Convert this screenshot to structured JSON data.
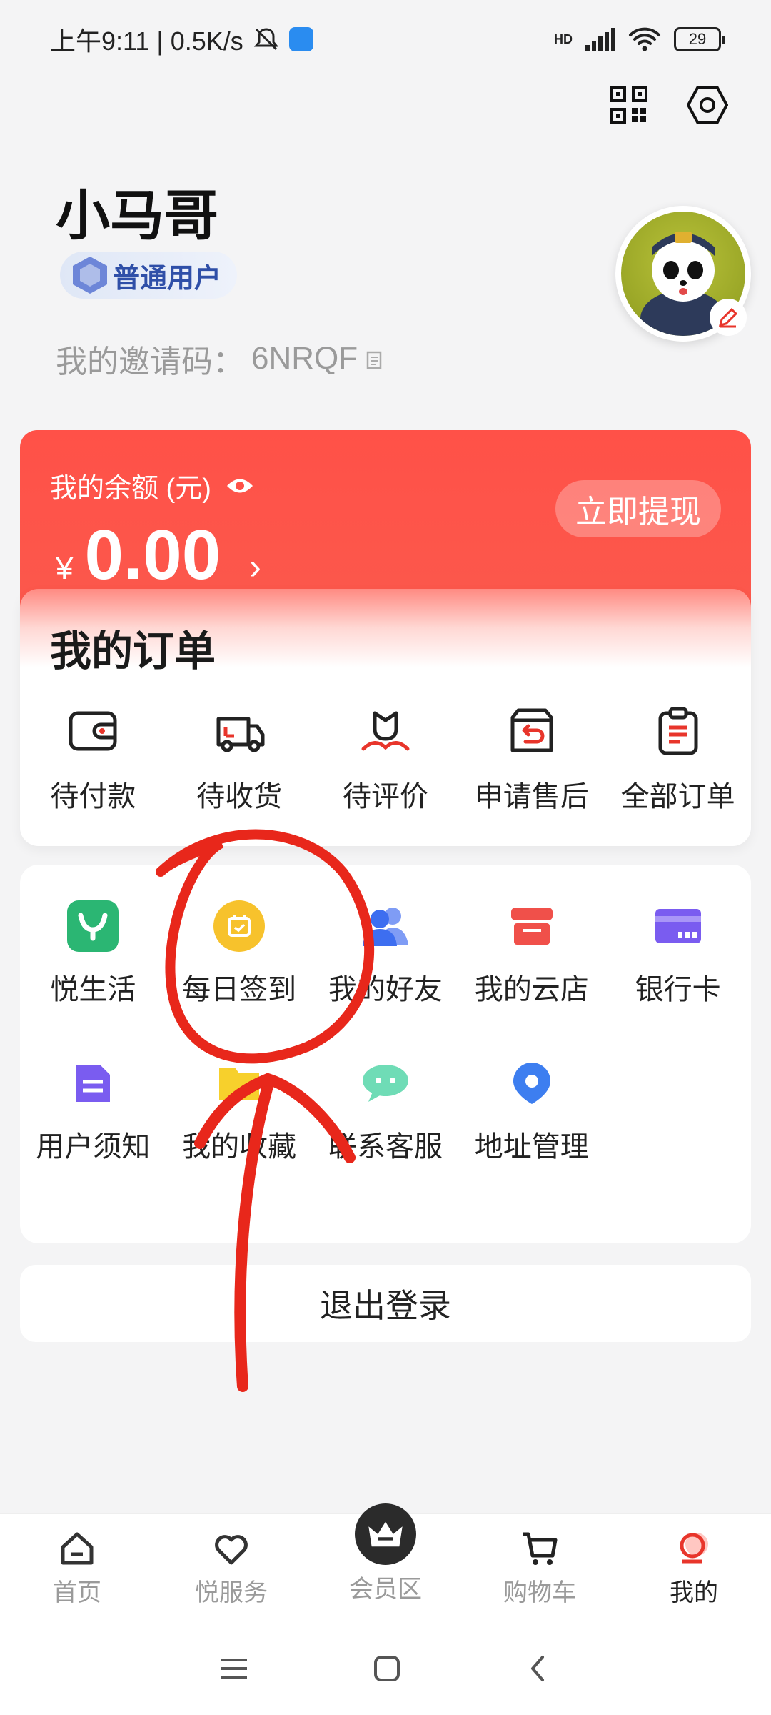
{
  "status_bar": {
    "time": "上午9:11 | 0.5K/s",
    "battery": "29",
    "network": "HD"
  },
  "profile": {
    "name": "小马哥",
    "level": "普通用户",
    "invite_label": "我的邀请码：",
    "invite_code": "6NRQF"
  },
  "balance": {
    "label": "我的余额 (元)",
    "currency": "¥",
    "amount": "0.00",
    "withdraw_label": "立即提现"
  },
  "orders": {
    "title": "我的订单",
    "items": [
      {
        "label": "待付款",
        "icon": "wallet-icon"
      },
      {
        "label": "待收货",
        "icon": "truck-icon"
      },
      {
        "label": "待评价",
        "icon": "flower-icon"
      },
      {
        "label": "申请售后",
        "icon": "return-box-icon"
      },
      {
        "label": "全部订单",
        "icon": "clipboard-icon"
      }
    ]
  },
  "services": [
    {
      "label": "悦生活",
      "icon": "yue-life-icon",
      "color": "#2bb673"
    },
    {
      "label": "每日签到",
      "icon": "calendar-check-icon",
      "color": "#f7c22c"
    },
    {
      "label": "我的好友",
      "icon": "friends-icon",
      "color": "#3d6ef0"
    },
    {
      "label": "我的云店",
      "icon": "store-icon",
      "color": "#f0504a"
    },
    {
      "label": "银行卡",
      "icon": "bank-card-icon",
      "color": "#7a5cf0"
    },
    {
      "label": "用户须知",
      "icon": "document-icon",
      "color": "#7a5cf0"
    },
    {
      "label": "我的收藏",
      "icon": "folder-icon",
      "color": "#f7c22c"
    },
    {
      "label": "联系客服",
      "icon": "chat-icon",
      "color": "#4fd1a8"
    },
    {
      "label": "地址管理",
      "icon": "location-pin-icon",
      "color": "#3d7ef0"
    }
  ],
  "logout_label": "退出登录",
  "bottom_nav": [
    {
      "label": "首页",
      "icon": "home-icon"
    },
    {
      "label": "悦服务",
      "icon": "heart-icon"
    },
    {
      "label": "会员区",
      "icon": "crown-icon"
    },
    {
      "label": "购物车",
      "icon": "cart-icon"
    },
    {
      "label": "我的",
      "icon": "profile-icon"
    }
  ],
  "colors": {
    "primary_red": "#ff5148",
    "annotation": "#e8271b"
  }
}
